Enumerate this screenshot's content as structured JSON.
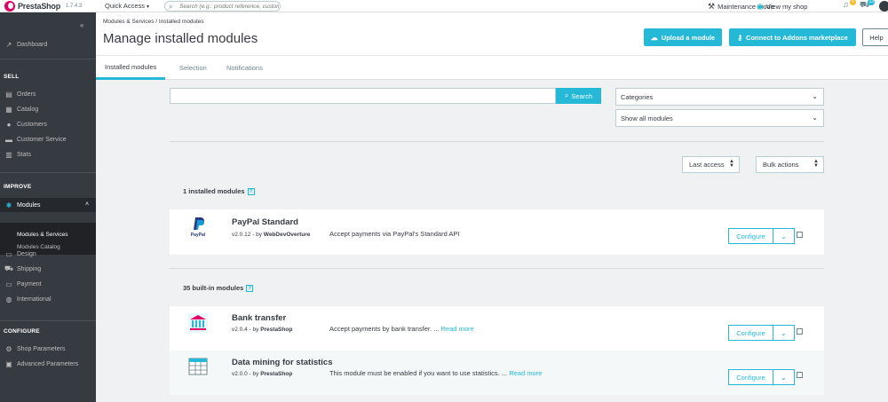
{
  "header": {
    "logo_text": "PrestaShop",
    "version": "1.7.4.3",
    "quick_access": "Quick Access",
    "search_placeholder": "Search (e.g.: product reference, custome",
    "maintenance": "Maintenance mode",
    "view_shop": "View my shop",
    "notif_count": "6",
    "orders_count": "13"
  },
  "sidebar": {
    "dashboard": "Dashboard",
    "sections": {
      "sell": "SELL",
      "improve": "IMPROVE",
      "configure": "CONFIGURE"
    },
    "sell_items": [
      "Orders",
      "Catalog",
      "Customers",
      "Customer Service",
      "Stats"
    ],
    "modules": "Modules",
    "modules_sub": [
      "Modules & Services",
      "Modules Catalog"
    ],
    "improve_items": [
      "Design",
      "Shipping",
      "Payment",
      "International"
    ],
    "configure_items": [
      "Shop Parameters",
      "Advanced Parameters"
    ]
  },
  "page": {
    "breadcrumb_parent": "Modules & Services",
    "breadcrumb_sep": "/",
    "breadcrumb_current": "Installed modules",
    "title": "Manage installed modules",
    "upload_label": "Upload a module",
    "connect_label": "Connect to Addons marketplace",
    "help_label": "Help"
  },
  "tabs": [
    "Installed modules",
    "Selection",
    "Notifications"
  ],
  "filters": {
    "search_value": "",
    "search_button": "Search",
    "categories": "Categories",
    "status": "Show all modules",
    "sort": "Last access",
    "bulk": "Bulk actions"
  },
  "installed_section": {
    "count_label": "1 installed modules",
    "help": "?"
  },
  "builtin_section": {
    "count_label": "35 built-in modules",
    "help": "?"
  },
  "modules": [
    {
      "name": "PayPal Standard",
      "version": "v2.0.12",
      "by": "- by",
      "author": "WebDevOverture",
      "description": "Accept payments via PayPal's Standard API",
      "read_more": "",
      "configure": "Configure",
      "icon": "paypal-logo"
    },
    {
      "name": "Bank transfer",
      "version": "v2.0.4",
      "by": "- by",
      "author": "PrestaShop",
      "description": "Accept payments by bank transfer. ...",
      "read_more": "Read more",
      "configure": "Configure",
      "icon": "bank-icon"
    },
    {
      "name": "Data mining for statistics",
      "version": "v2.0.0",
      "by": "- by",
      "author": "PrestaShop",
      "description": "This module must be enabled if you want to use statistics. ...",
      "read_more": "Read more",
      "configure": "Configure",
      "icon": "table-icon"
    }
  ],
  "colors": {
    "accent": "#25b9d7",
    "sidebar_bg": "#363a41",
    "brand": "#df0067"
  }
}
